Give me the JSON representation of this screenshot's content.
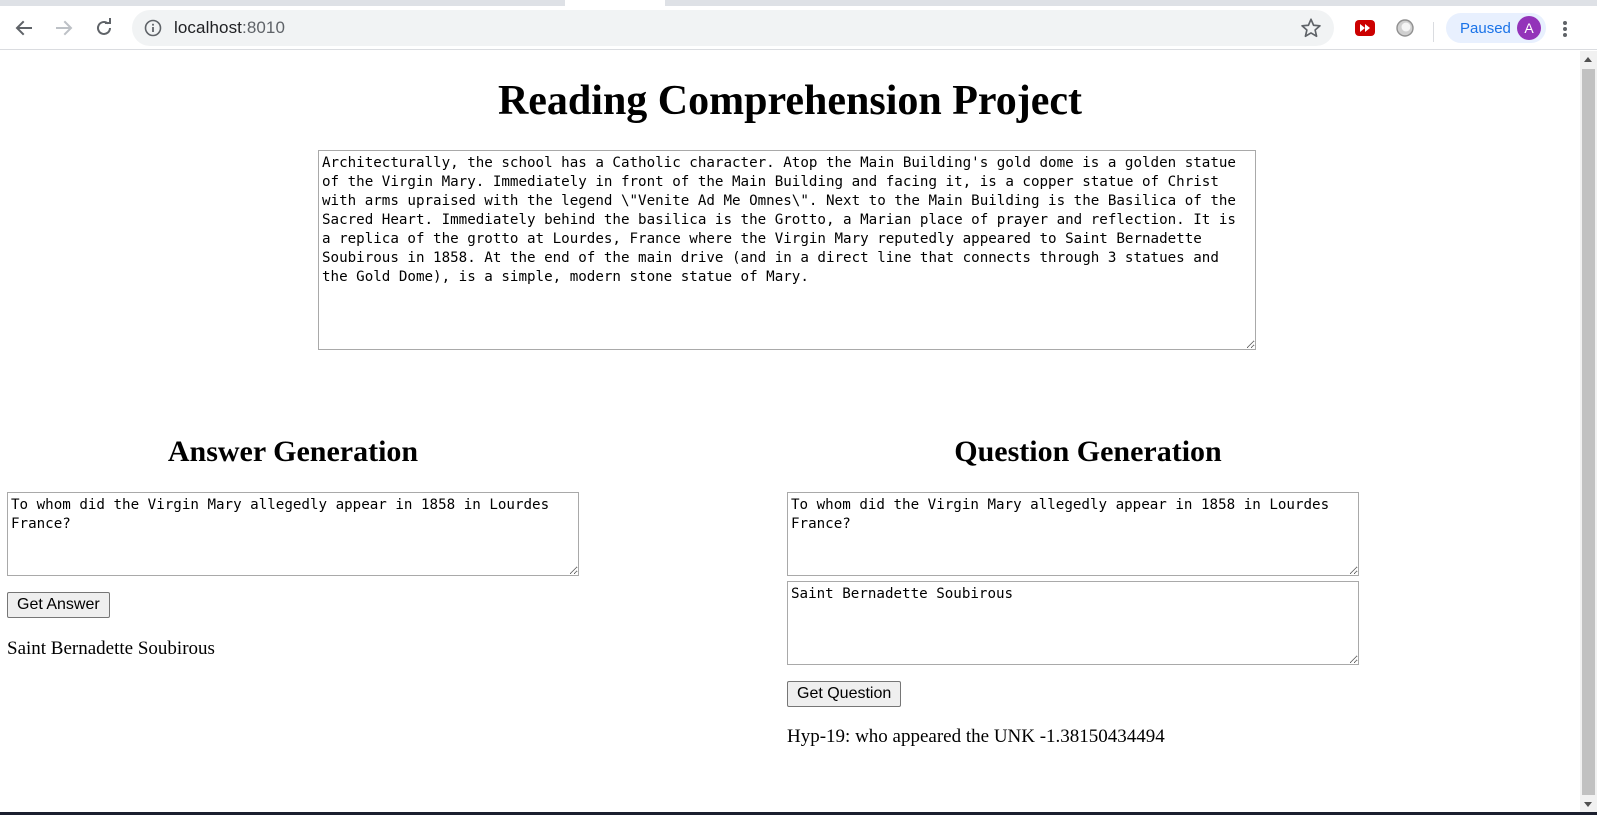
{
  "browser": {
    "url_host": "localhost",
    "url_port": ":8010",
    "profile_status": "Paused",
    "profile_initial": "A"
  },
  "page": {
    "title": "Reading Comprehension Project",
    "passage": "Architecturally, the school has a Catholic character. Atop the Main Building's gold dome is a golden statue of the Virgin Mary. Immediately in front of the Main Building and facing it, is a copper statue of Christ with arms upraised with the legend \\\"Venite Ad Me Omnes\\\". Next to the Main Building is the Basilica of the Sacred Heart. Immediately behind the basilica is the Grotto, a Marian place of prayer and reflection. It is a replica of the grotto at Lourdes, France where the Virgin Mary reputedly appeared to Saint Bernadette Soubirous in 1858. At the end of the main drive (and in a direct line that connects through 3 statues and the Gold Dome), is a simple, modern stone statue of Mary."
  },
  "answer_generation": {
    "heading": "Answer Generation",
    "question": "To whom did the Virgin Mary allegedly appear in 1858 in Lourdes France?",
    "button_label": "Get Answer",
    "result": "Saint Bernadette Soubirous"
  },
  "question_generation": {
    "heading": "Question Generation",
    "context_question": "To whom did the Virgin Mary allegedly appear in 1858 in Lourdes France?",
    "answer": "Saint Bernadette Soubirous",
    "button_label": "Get Question",
    "result": "Hyp-19: who appeared the UNK -1.38150434494"
  },
  "icons": {
    "back": "arrow-left-icon",
    "forward": "arrow-right-icon",
    "reload": "reload-icon",
    "info": "info-icon",
    "bookmark": "star-icon",
    "extension_1": "youtube-extension-icon",
    "extension_2": "circle-extension-icon",
    "menu": "kebab-menu-icon"
  },
  "colors": {
    "paused_bg": "#e8f0fe",
    "paused_text": "#1a73e8",
    "avatar_bg": "#9334b9",
    "extension_red": "#cc0000"
  }
}
